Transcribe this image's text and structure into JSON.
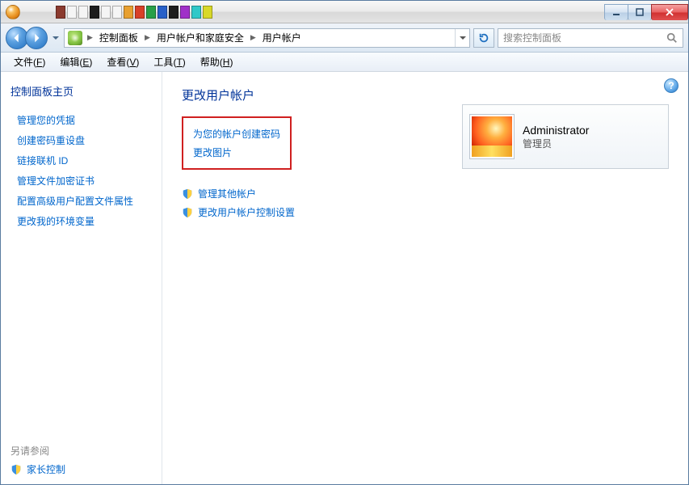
{
  "swatch_colors": [
    "#8b3a2e",
    "#f5f5f5",
    "#f5f5f5",
    "#1e1e1e",
    "#f5f5f5",
    "#f5f5f5",
    "#e8a030",
    "#d84028",
    "#28a048",
    "#2860c8",
    "#1e1e1e",
    "#a030c8",
    "#30c8c8",
    "#d8d828"
  ],
  "breadcrumb": [
    "控制面板",
    "用户帐户和家庭安全",
    "用户帐户"
  ],
  "search": {
    "placeholder": "搜索控制面板"
  },
  "menu": {
    "file": {
      "label": "文件",
      "key": "F"
    },
    "edit": {
      "label": "编辑",
      "key": "E"
    },
    "view": {
      "label": "查看",
      "key": "V"
    },
    "tools": {
      "label": "工具",
      "key": "T"
    },
    "help": {
      "label": "帮助",
      "key": "H"
    }
  },
  "sidebar": {
    "home": "控制面板主页",
    "links": [
      "管理您的凭据",
      "创建密码重设盘",
      "链接联机 ID",
      "管理文件加密证书",
      "配置高级用户配置文件属性",
      "更改我的环境变量"
    ],
    "seealso": "另请参阅",
    "parental": "家长控制"
  },
  "main": {
    "heading": "更改用户帐户",
    "boxed_links": [
      "为您的帐户创建密码",
      "更改图片"
    ],
    "shield_links": [
      "管理其他帐户",
      "更改用户帐户控制设置"
    ]
  },
  "account": {
    "name": "Administrator",
    "role": "管理员"
  }
}
